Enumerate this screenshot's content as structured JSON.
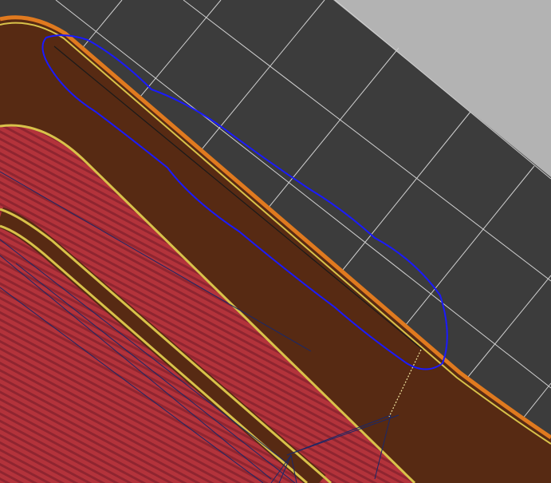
{
  "viewer": {
    "background_color": "#3c3c3c",
    "bed_margin_color": "#b3b3b3",
    "grid_color": "#d0d0d0",
    "layer_colors": {
      "perimeter_outer": "#e07a1f",
      "perimeter_inner": "#d8c24a",
      "wall_fill": "#572a13",
      "solid_infill": "#b3333b",
      "infill_stripe": "#8f2530",
      "travel_move": "#1a2868",
      "retract_seam": "#f2e6a0"
    },
    "annotation": {
      "shape": "freehand-loop",
      "color": "#1a1aff"
    }
  }
}
